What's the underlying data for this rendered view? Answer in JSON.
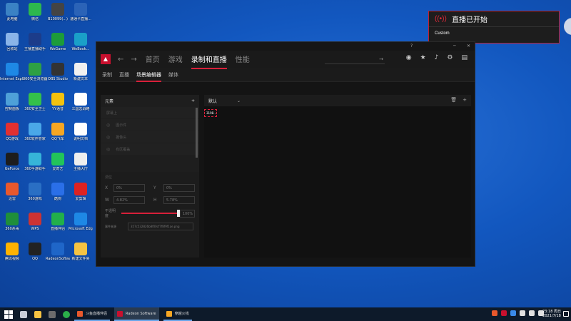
{
  "desktop_icons": [
    {
      "label": "此电脑",
      "color": "#3b82c4"
    },
    {
      "label": "微信",
      "color": "#2db84d"
    },
    {
      "label": "B10099(...)",
      "color": "#444"
    },
    {
      "label": "速通卡直播...",
      "color": "#2b63b7"
    },
    {
      "label": "回收站",
      "color": "#8ab4e8"
    },
    {
      "label": "主播直播助手",
      "color": "#1c3c8a"
    },
    {
      "label": "WeGame",
      "color": "#1d9c3a"
    },
    {
      "label": "WeBook...",
      "color": "#1aa0c8"
    },
    {
      "label": "Internet Explorer",
      "color": "#1e88e5"
    },
    {
      "label": "360安全浏览器",
      "color": "#2ea043"
    },
    {
      "label": "OBS Studio",
      "color": "#333"
    },
    {
      "label": "新建文本",
      "color": "#f0f0f0"
    },
    {
      "label": "控制面板",
      "color": "#4ea0d8"
    },
    {
      "label": "360安全卫士",
      "color": "#34c04a"
    },
    {
      "label": "YY语音",
      "color": "#f4c20d"
    },
    {
      "label": "三国志战略",
      "color": "#fff"
    },
    {
      "label": "QQ游戏",
      "color": "#e23030"
    },
    {
      "label": "360软件管家",
      "color": "#4aa8e8"
    },
    {
      "label": "QQ飞车",
      "color": "#f6a623"
    },
    {
      "label": "说明文档",
      "color": "#fff"
    },
    {
      "label": "GeForce",
      "color": "#1d1d1d"
    },
    {
      "label": "360手游助手",
      "color": "#36b4d8"
    },
    {
      "label": "爱奇艺",
      "color": "#22c45a"
    },
    {
      "label": "主播大厅",
      "color": "#eee"
    },
    {
      "label": "迅雷",
      "color": "#e8582c"
    },
    {
      "label": "360游戏",
      "color": "#2a6fc4"
    },
    {
      "label": "酷狗",
      "color": "#2a6fe8"
    },
    {
      "label": "爱剪辑",
      "color": "#d22"
    },
    {
      "label": "360杀毒",
      "color": "#1f8f3a"
    },
    {
      "label": "WPS",
      "color": "#c33"
    },
    {
      "label": "直播伴侣",
      "color": "#22b04a"
    },
    {
      "label": "Microsoft Edge",
      "color": "#1e88e5"
    },
    {
      "label": "腾讯视频",
      "color": "#ffb300"
    },
    {
      "label": "QQ",
      "color": "#222"
    },
    {
      "label": "RadeonSoftware",
      "color": "#1f66c8"
    },
    {
      "label": "新建文件夹",
      "color": "#f6c342"
    }
  ],
  "toast": {
    "title": "直播已开始",
    "subtitle": "Custom"
  },
  "window": {
    "nav_tabs": [
      "首页",
      "游戏",
      "录制和直播",
      "性能"
    ],
    "active_tab_index": 2,
    "search_placeholder": "",
    "sub_tabs": [
      "录制",
      "直播",
      "场景编辑器",
      "媒体"
    ],
    "active_sub_tab_index": 2,
    "elements_title": "元素",
    "element_rows": [
      "屏幕上",
      "图示件",
      "摄像头",
      "有区覆盖",
      ""
    ],
    "props": {
      "section_label": "调位",
      "x_label": "X",
      "x_value": "0%",
      "y_label": "Y",
      "y_value": "0%",
      "w_label": "W",
      "w_value": "4.82%",
      "h_label": "H",
      "h_value": "5.78%",
      "opacity_label": "不透明度",
      "opacity_value": "100%",
      "opacity_fraction": 1.0,
      "file_label": "事件来源",
      "file_value": "357c532826b8f00cf7f8f9f1ae.png"
    },
    "scene_name": "默认",
    "selected_item": "3198..."
  },
  "taskbar": {
    "apps": [
      {
        "label": "斗鱼直播伴侣",
        "color": "#e8582c",
        "active": false
      },
      {
        "label": "Radeon Software",
        "color": "#c8102e",
        "active": true
      },
      {
        "label": "穿越火线",
        "color": "#f6a623",
        "active": false
      }
    ],
    "time": "23:18 周日",
    "date": "2021/7/18"
  }
}
